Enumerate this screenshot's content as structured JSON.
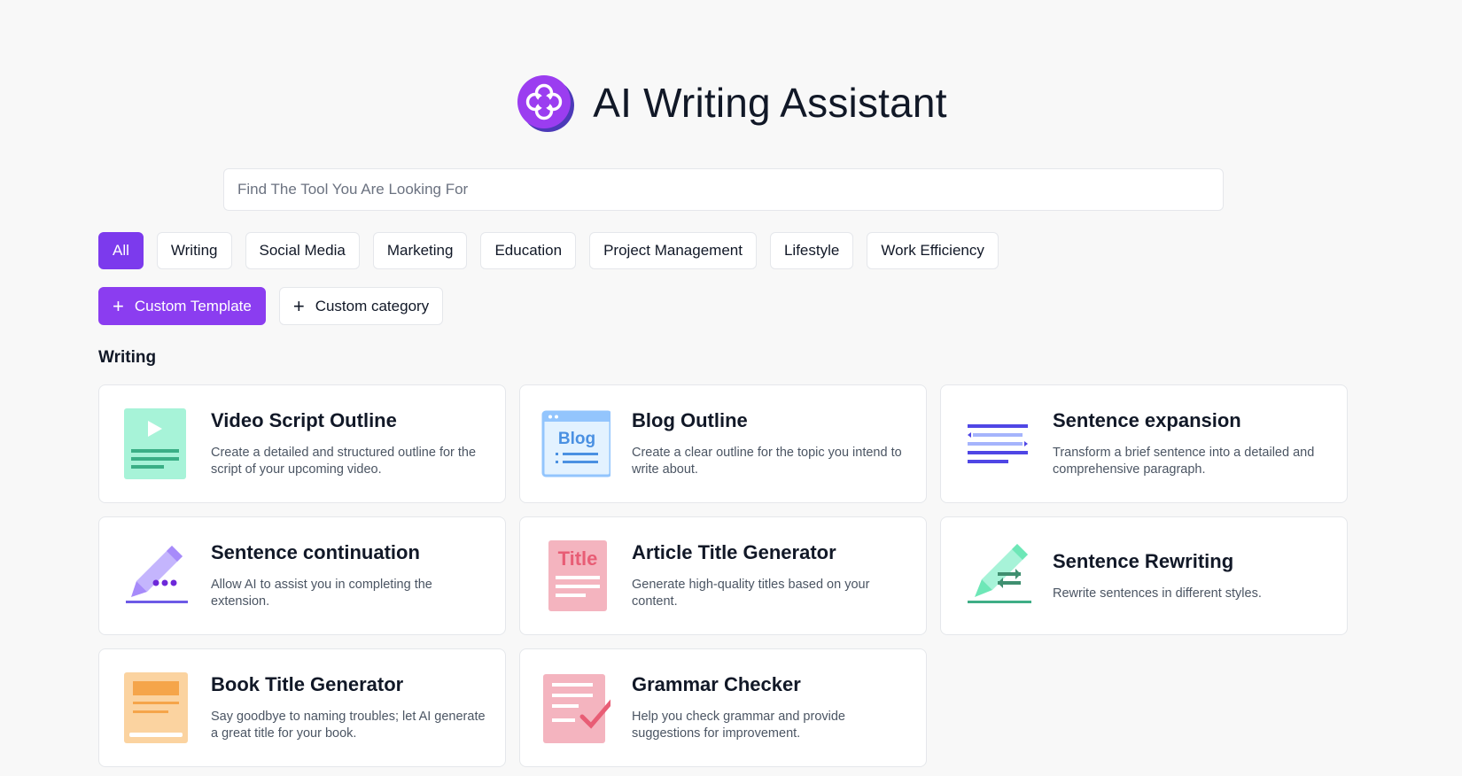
{
  "app": {
    "title": "AI Writing Assistant",
    "logo_icon": "flower-logo-icon",
    "accent_color": "#7c3aed"
  },
  "search": {
    "placeholder": "Find The Tool You Are Looking For",
    "value": ""
  },
  "tabs": [
    {
      "label": "All",
      "active": true
    },
    {
      "label": "Writing",
      "active": false
    },
    {
      "label": "Social Media",
      "active": false
    },
    {
      "label": "Marketing",
      "active": false
    },
    {
      "label": "Education",
      "active": false
    },
    {
      "label": "Project Management",
      "active": false
    },
    {
      "label": "Lifestyle",
      "active": false
    },
    {
      "label": "Work Efficiency",
      "active": false
    }
  ],
  "actions": {
    "custom_template": "Custom Template",
    "custom_category": "Custom category"
  },
  "section": {
    "title": "Writing"
  },
  "cards": [
    {
      "title": "Video Script Outline",
      "desc": "Create a detailed and structured outline for the script of your upcoming video.",
      "icon": "video-script-icon"
    },
    {
      "title": "Blog Outline",
      "desc": "Create a clear outline for the topic you intend to write about.",
      "icon": "blog-icon",
      "icon_text": "Blog"
    },
    {
      "title": "Sentence expansion",
      "desc": "Transform a brief sentence into a detailed and comprehensive paragraph.",
      "icon": "expand-lines-icon"
    },
    {
      "title": "Sentence continuation",
      "desc": "Allow AI to assist you in completing the extension.",
      "icon": "pen-continue-icon"
    },
    {
      "title": "Article Title Generator",
      "desc": "Generate high-quality titles based on your content.",
      "icon": "article-title-icon",
      "icon_text": "Title"
    },
    {
      "title": "Sentence Rewriting",
      "desc": "Rewrite sentences in different styles.",
      "icon": "pen-rewrite-icon"
    },
    {
      "title": "Book Title Generator",
      "desc": "Say goodbye to naming troubles; let AI generate a great title for your book.",
      "icon": "book-title-icon"
    },
    {
      "title": "Grammar Checker",
      "desc": "Help you check grammar and provide suggestions for improvement.",
      "icon": "grammar-check-icon"
    }
  ]
}
